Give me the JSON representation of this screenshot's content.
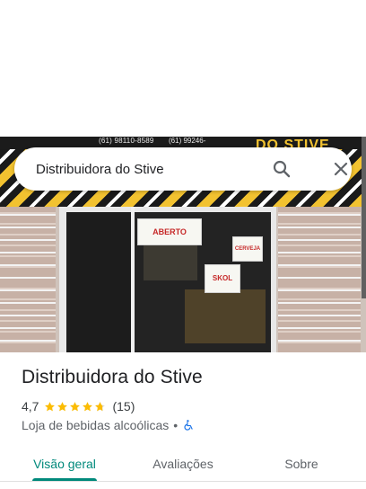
{
  "search": {
    "value": "Distribuidora do Stive"
  },
  "photo": {
    "sign_phone_1": "(61) 98110-8589",
    "sign_phone_2": "(61) 99246-",
    "sign_brand": "DO STIVE",
    "paper_1": "ABERTO",
    "paper_2": "CERVEJA",
    "paper_3": "SKOL"
  },
  "place": {
    "title": "Distribuidora do Stive",
    "rating": "4,7",
    "rating_value": 4.7,
    "review_count": "(15)",
    "category": "Loja de bebidas alcoólicas",
    "separator": "•"
  },
  "tabs": [
    {
      "label": "Visão geral"
    },
    {
      "label": "Avaliações"
    },
    {
      "label": "Sobre"
    }
  ],
  "colors": {
    "accent": "#00897b",
    "star": "#fbbc04",
    "accessibility": "#1a73e8"
  },
  "icons": {
    "search": "search-icon",
    "close": "close-icon",
    "accessibility": "wheelchair-icon",
    "star": "star-icon"
  }
}
